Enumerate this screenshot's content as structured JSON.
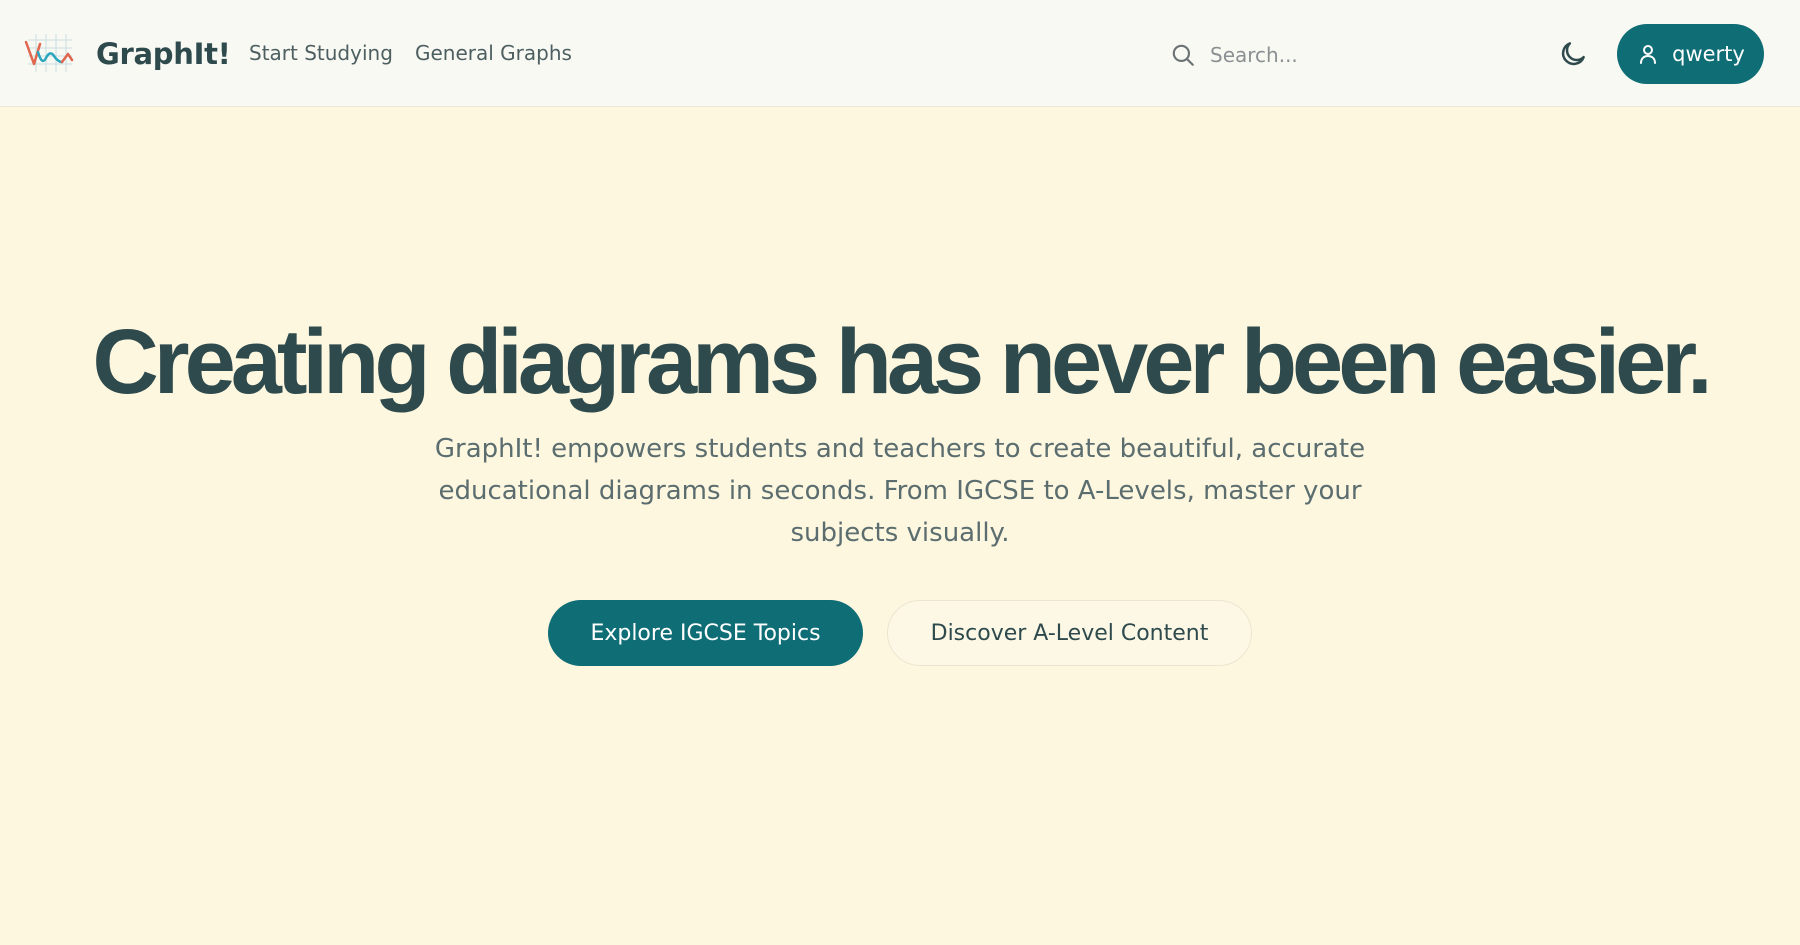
{
  "colors": {
    "page_background": "#fdf7e0",
    "navbar_background": "#f9f9f4",
    "accent": "#0f6d76",
    "heading": "#2e4a4d",
    "body_text": "#5b6d6e"
  },
  "header": {
    "logo_icon": "graph-logo-icon",
    "brand": "GraphIt!",
    "nav": [
      {
        "label": "Start Studying"
      },
      {
        "label": "General Graphs"
      }
    ],
    "search": {
      "icon": "search-icon",
      "placeholder": "Search..."
    },
    "theme_toggle_icon": "moon-icon",
    "user": {
      "icon": "user-icon",
      "name": "qwerty"
    }
  },
  "hero": {
    "title": "Creating diagrams has never been easier.",
    "subtitle": "GraphIt! empowers students and teachers to create beautiful, accurate educational diagrams in seconds. From IGCSE to A-Levels, master your subjects visually.",
    "primary_cta": "Explore IGCSE Topics",
    "secondary_cta": "Discover A-Level Content"
  }
}
